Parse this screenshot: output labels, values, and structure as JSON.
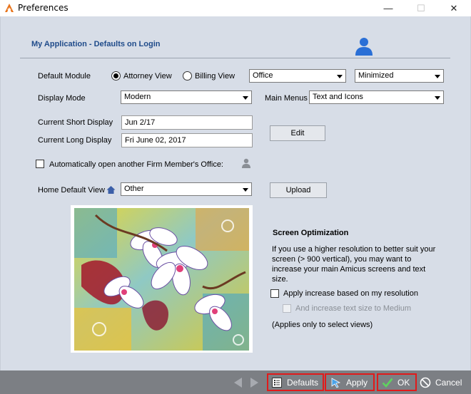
{
  "window": {
    "title": "Preferences",
    "minimize_glyph": "—",
    "maximize_glyph": "☐",
    "close_glyph": "✕"
  },
  "header": {
    "section_title": "My Application - Defaults on Login"
  },
  "form": {
    "default_module_label": "Default Module",
    "attorney_view_label": "Attorney View",
    "billing_view_label": "Billing View",
    "selected_module": "Attorney View",
    "office_select": "Office",
    "window_state_select": "Minimized",
    "display_mode_label": "Display Mode",
    "display_mode_select": "Modern",
    "main_menus_label": "Main Menus",
    "main_menus_select": "Text and Icons",
    "short_display_label": "Current Short Display",
    "short_display_value": "Jun 2/17",
    "long_display_label": "Current Long Display",
    "long_display_value": "Fri June 02, 2017",
    "edit_button": "Edit",
    "auto_open_label": "Automatically open another Firm Member's Office:",
    "auto_open_checked": false,
    "home_view_label": "Home Default View",
    "home_view_select": "Other",
    "upload_button": "Upload"
  },
  "screen_optimization": {
    "title": "Screen Optimization",
    "description": "If you use a higher resolution to better suit your screen (> 900 vertical), you may want to increase your main Amicus screens and text size.",
    "apply_increase_label": "Apply increase based on my resolution",
    "apply_increase_checked": false,
    "increase_text_label": "And increase text size to Medium",
    "increase_text_checked": false,
    "note": "(Applies only to select views)"
  },
  "footer": {
    "defaults_button": "Defaults",
    "apply_button": "Apply",
    "ok_button": "OK",
    "cancel_button": "Cancel"
  },
  "colors": {
    "client_bg": "#d7dde7",
    "section_title": "#1f4b8a",
    "bottom_bar": "#7c7f84",
    "highlight_border": "#e11a1a",
    "user_icon": "#2a6fd6"
  }
}
